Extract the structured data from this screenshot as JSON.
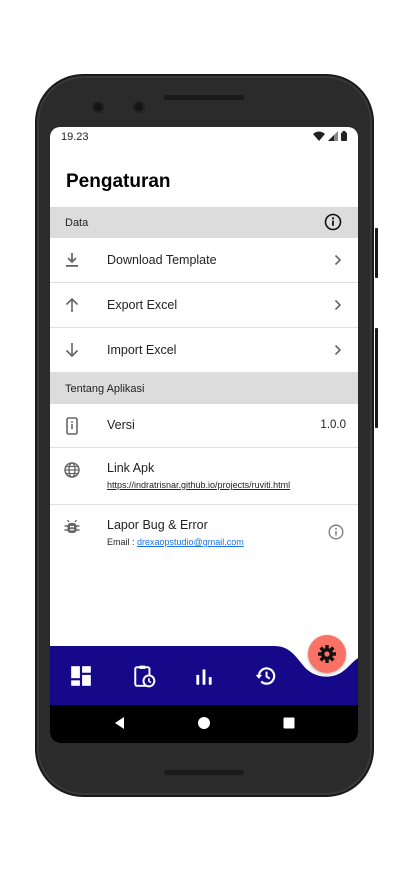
{
  "status": {
    "time": "19.23"
  },
  "page": {
    "title": "Pengaturan"
  },
  "sections": {
    "data": {
      "label": "Data"
    },
    "about": {
      "label": "Tentang Aplikasi"
    }
  },
  "menu": {
    "download_template": "Download Template",
    "export_excel": "Export Excel",
    "import_excel": "Import Excel"
  },
  "about": {
    "version_label": "Versi",
    "version_value": "1.0.0",
    "link_label": "Link Apk",
    "link_url": "https://indratrisnar.github.io/projects/ruviti.html",
    "bug_label": "Lapor Bug & Error",
    "email_prefix": "Email : ",
    "email": "drexaopstudio@gmail.com"
  },
  "colors": {
    "nav_bar": "#15098a",
    "fab": "#fa7165",
    "section_bg": "#dcdcdc"
  },
  "icons": {
    "nav": [
      "dashboard-icon",
      "clipboard-clock-icon",
      "bar-chart-icon",
      "history-icon"
    ],
    "fab": "gear-icon"
  }
}
